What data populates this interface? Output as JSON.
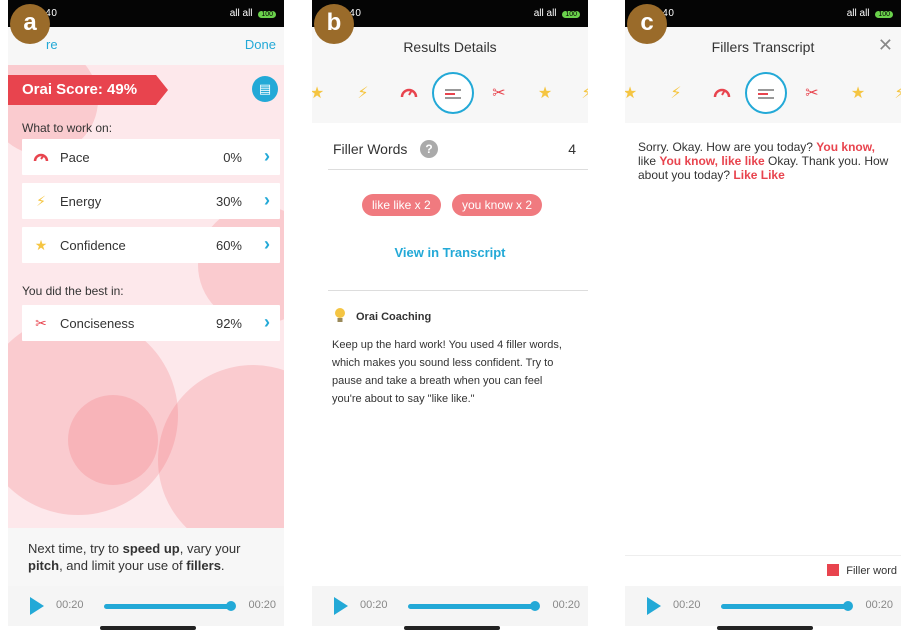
{
  "status_bar": {
    "time": ":40",
    "network": "all all",
    "battery": "100"
  },
  "panel_a": {
    "badge": "a",
    "left_link": "re",
    "right_link": "Done",
    "score_label": "Orai Score: 49%",
    "work_on_label": "What to work on:",
    "metrics": [
      {
        "label": "Pace",
        "value": "0%"
      },
      {
        "label": "Energy",
        "value": "30%"
      },
      {
        "label": "Confidence",
        "value": "60%"
      }
    ],
    "best_label": "You did the best in:",
    "best": {
      "label": "Conciseness",
      "value": "92%"
    },
    "next_prefix": "Next time, try to ",
    "next_speed": "speed up",
    "next_mid1": ", vary your ",
    "next_pitch": "pitch",
    "next_mid2": ", and limit your use of ",
    "next_fillers": "fillers",
    "next_suffix": "."
  },
  "panel_b": {
    "badge": "b",
    "title": "Results Details",
    "filler_label": "Filler Words",
    "filler_count": "4",
    "help_glyph": "?",
    "chips": [
      "like like  x 2",
      "you know  x 2"
    ],
    "view_transcript": "View in Transcript",
    "coach_title": "Orai Coaching",
    "coach_text": "Keep up the hard work! You used 4 filler words, which makes you sound less confident. Try to pause and take a breath when you can feel you're about to say \"like like.\""
  },
  "panel_c": {
    "badge": "c",
    "title": "Fillers Transcript",
    "close_glyph": "✕",
    "transcript_segments": [
      {
        "text": "Sorry. Okay. How are you today? ",
        "filler": false
      },
      {
        "text": "You know,",
        "filler": true
      },
      {
        "text": " like ",
        "filler": false
      },
      {
        "text": "You know, like like",
        "filler": true
      },
      {
        "text": " Okay. Thank you. How about you today? ",
        "filler": false
      },
      {
        "text": "Like Like",
        "filler": true
      }
    ],
    "legend_label": "Filler word"
  },
  "player": {
    "start_time": "00:20",
    "end_time": "00:20",
    "progress": 1.0
  },
  "colors": {
    "accent": "#23a9d7",
    "score_red": "#e8444e",
    "chip": "#f07a7f",
    "status_bar": "#050505"
  },
  "icons": {
    "pace": "speedometer-icon",
    "energy": "lightning-icon",
    "confidence": "stars-icon",
    "conciseness": "scissors-icon",
    "fillers": "filler-lines-icon",
    "coaching": "lightbulb-icon",
    "report": "document-icon"
  }
}
